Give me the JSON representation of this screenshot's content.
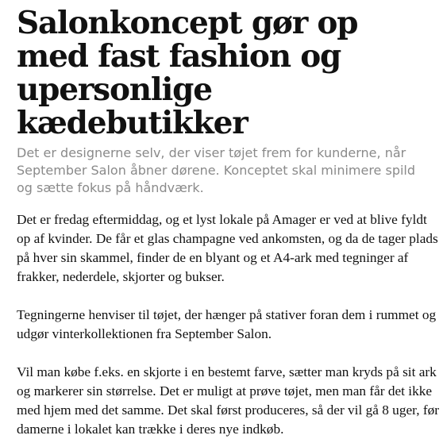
{
  "article": {
    "headline": "Salonkoncept gør op med fast fashion og upersonlige kædebutikker",
    "lead": "Det er designerne selv, der viser tøjet frem for kunderne, når September Salon åbner dørene. Konceptet skal minimere spild og sætte fokus på håndværk.",
    "paragraphs": [
      "Det er fredag eftermiddag, og et lyst lokale på Amager er ved at blive fyldt op af kvinder. De får et glas champagne ved ankomsten, og da de tager plads på hver sin skammel, finder de en blyant og et A4-ark med tegninger af frakker, nederdele, skjorter og bukser.",
      "Tegningerne henviser til tøjet, der hænger på stativer foran dem i rummet og udgør vinterkollektionen fra September Salon.",
      "Vil man købe f.eks. en skjorte i en bestemt farve, sætter man kryds på sit ark og markerer sin størrelse. Det er muligt at prøve tøjet, men man får det ikke med hjem med det samme. Det skal først produceres, så der vil gå 8 uger, før damerne i lokalet kan trække i deres nye indkøb."
    ]
  }
}
